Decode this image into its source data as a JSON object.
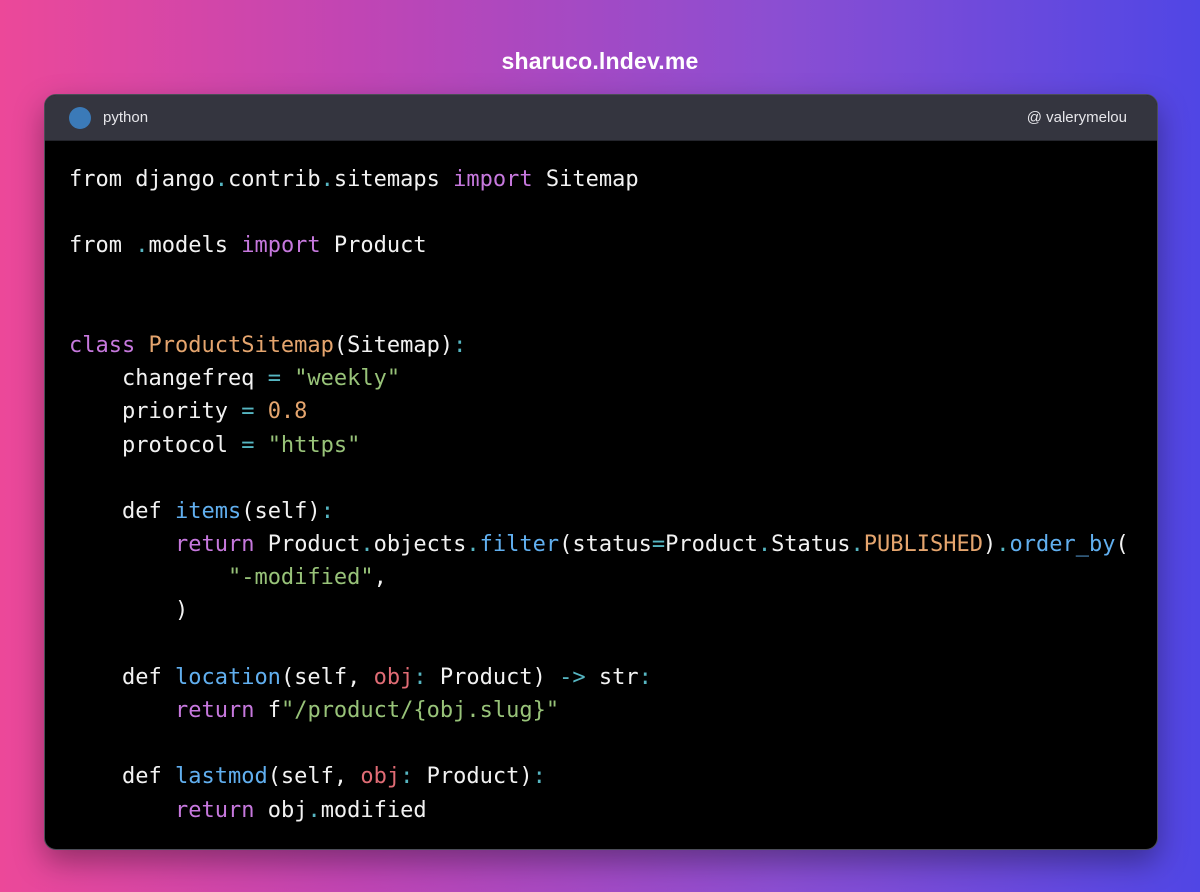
{
  "header": {
    "site": "sharuco.lndev.me"
  },
  "window": {
    "language": "python",
    "author": "@ valerymelou",
    "language_color": "#3b7ab8"
  },
  "colors": {
    "keyword": "#c678dd",
    "function": "#61afef",
    "class": "#e5a56e",
    "string": "#98c379",
    "number": "#e5a56e",
    "operator": "#56b6c2",
    "parameter": "#e06c75",
    "text": "#f2f2f2",
    "code_background": "#000000"
  },
  "code_lines": [
    [
      [
        "plain",
        "from django"
      ],
      [
        "op",
        "."
      ],
      [
        "plain",
        "contrib"
      ],
      [
        "op",
        "."
      ],
      [
        "plain",
        "sitemaps "
      ],
      [
        "kw",
        "import"
      ],
      [
        "plain",
        " Sitemap"
      ]
    ],
    [],
    [
      [
        "plain",
        "from "
      ],
      [
        "op",
        "."
      ],
      [
        "plain",
        "models "
      ],
      [
        "kw",
        "import"
      ],
      [
        "plain",
        " Product"
      ]
    ],
    [],
    [],
    [
      [
        "kw",
        "class"
      ],
      [
        "plain",
        " "
      ],
      [
        "cls",
        "ProductSitemap"
      ],
      [
        "plain",
        "(Sitemap)"
      ],
      [
        "op",
        ":"
      ]
    ],
    [
      [
        "plain",
        "    changefreq "
      ],
      [
        "op",
        "="
      ],
      [
        "plain",
        " "
      ],
      [
        "str",
        "\"weekly\""
      ]
    ],
    [
      [
        "plain",
        "    priority "
      ],
      [
        "op",
        "="
      ],
      [
        "plain",
        " "
      ],
      [
        "num",
        "0.8"
      ]
    ],
    [
      [
        "plain",
        "    protocol "
      ],
      [
        "op",
        "="
      ],
      [
        "plain",
        " "
      ],
      [
        "str",
        "\"https\""
      ]
    ],
    [],
    [
      [
        "plain",
        "    def "
      ],
      [
        "fn",
        "items"
      ],
      [
        "plain",
        "(self)"
      ],
      [
        "op",
        ":"
      ]
    ],
    [
      [
        "plain",
        "        "
      ],
      [
        "kw",
        "return"
      ],
      [
        "plain",
        " Product"
      ],
      [
        "op",
        "."
      ],
      [
        "plain",
        "objects"
      ],
      [
        "op",
        "."
      ],
      [
        "fn",
        "filter"
      ],
      [
        "plain",
        "(status"
      ],
      [
        "op",
        "="
      ],
      [
        "plain",
        "Product"
      ],
      [
        "op",
        "."
      ],
      [
        "plain",
        "Status"
      ],
      [
        "op",
        "."
      ],
      [
        "cls",
        "PUBLISHED"
      ],
      [
        "plain",
        ")"
      ],
      [
        "op",
        "."
      ],
      [
        "fn",
        "order_by"
      ],
      [
        "plain",
        "("
      ]
    ],
    [
      [
        "plain",
        "            "
      ],
      [
        "str",
        "\"-modified\""
      ],
      [
        "plain",
        ","
      ]
    ],
    [
      [
        "plain",
        "        )"
      ]
    ],
    [],
    [
      [
        "plain",
        "    def "
      ],
      [
        "fn",
        "location"
      ],
      [
        "plain",
        "(self, "
      ],
      [
        "param",
        "obj"
      ],
      [
        "op",
        ":"
      ],
      [
        "plain",
        " Product) "
      ],
      [
        "op",
        "->"
      ],
      [
        "plain",
        " str"
      ],
      [
        "op",
        ":"
      ]
    ],
    [
      [
        "plain",
        "        "
      ],
      [
        "kw",
        "return"
      ],
      [
        "plain",
        " f"
      ],
      [
        "str",
        "\"/product/{obj.slug}\""
      ]
    ],
    [],
    [
      [
        "plain",
        "    def "
      ],
      [
        "fn",
        "lastmod"
      ],
      [
        "plain",
        "(self, "
      ],
      [
        "param",
        "obj"
      ],
      [
        "op",
        ":"
      ],
      [
        "plain",
        " Product)"
      ],
      [
        "op",
        ":"
      ]
    ],
    [
      [
        "plain",
        "        "
      ],
      [
        "kw",
        "return"
      ],
      [
        "plain",
        " obj"
      ],
      [
        "op",
        "."
      ],
      [
        "plain",
        "modified"
      ]
    ]
  ]
}
